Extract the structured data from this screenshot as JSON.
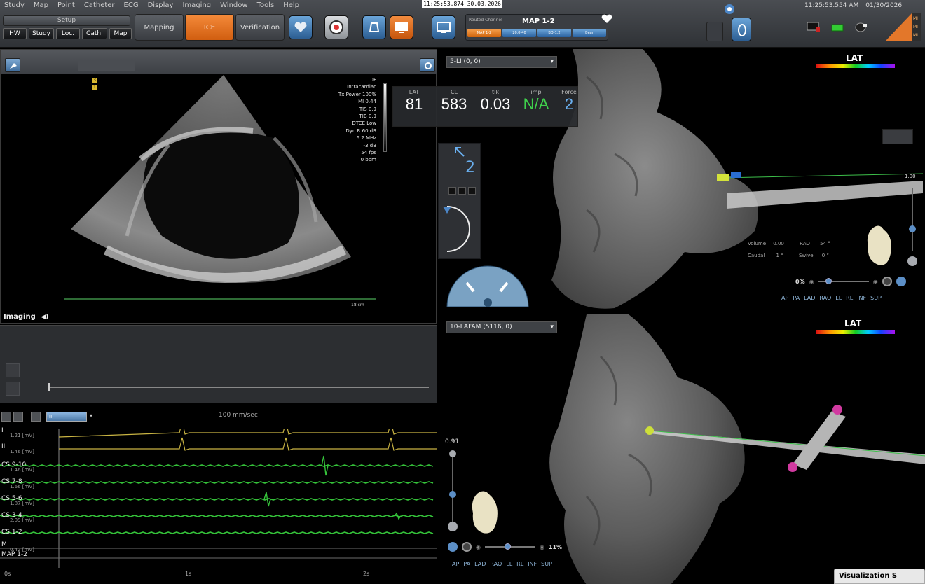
{
  "menu": [
    "Study",
    "Map",
    "Point",
    "Catheter",
    "ECG",
    "Display",
    "Imaging",
    "Window",
    "Tools",
    "Help"
  ],
  "clock_center": "11:25:53.874  30.03.2026",
  "clock_right": {
    "time": "11:25:53.554 AM",
    "date": "01/30/2026"
  },
  "setup": {
    "label": "Setup",
    "buttons": [
      "HW",
      "Study",
      "Loc.",
      "Cath.",
      "Map"
    ]
  },
  "workflow": {
    "mapping": "Mapping",
    "ice": "ICE",
    "verification": "Verification",
    "active": "ICE"
  },
  "routed_channel": {
    "label": "Routed Channel",
    "value": "MAP 1-2",
    "chips": [
      "MAP 1-2",
      "20.0-40",
      "BO-1.2",
      "Bear"
    ]
  },
  "ultrasound": {
    "params": [
      "10F",
      "Intracardiac",
      "Tx Power 100%",
      "MI 0.44",
      "TIS 0.9",
      "TIB 0.9",
      "DTCE Low",
      "Dyn R 60 dB",
      "6.2 MHz",
      "-3 dB",
      "54 fps",
      "0 bpm"
    ],
    "depth": "18 cm",
    "imaging_label": "Imaging",
    "marker_top": "3",
    "marker_bottom": "1"
  },
  "ecg": {
    "speed": "100 mm/sec",
    "dropdown": "II",
    "channels": [
      {
        "name": "I",
        "scale": "1.21 [mV]"
      },
      {
        "name": "II",
        "scale": "1.46 [mV]"
      },
      {
        "name": "CS 9-10",
        "scale": "1.46 [mV]"
      },
      {
        "name": "CS 7-8",
        "scale": "1.66 [mV]"
      },
      {
        "name": "CS 5-6",
        "scale": "1.87 [mV]"
      },
      {
        "name": "CS 3-4",
        "scale": "2.09 [mV]"
      },
      {
        "name": "CS 1-2",
        "scale": ""
      },
      {
        "name": "M",
        "scale": "0.42 [mV]"
      },
      {
        "name": "MAP 1-2",
        "scale": ""
      }
    ],
    "time_ticks": [
      "0s",
      "1s",
      "2s"
    ],
    "colors": {
      "surface": "#c9b443",
      "intracardiac": "#35c43a"
    }
  },
  "readouts": [
    {
      "label": "LAT",
      "value": "81",
      "color": "#ffffff"
    },
    {
      "label": "CL",
      "value": "583",
      "color": "#ffffff"
    },
    {
      "label": "tlk",
      "value": "0.03",
      "color": "#ffffff"
    },
    {
      "label": "imp",
      "value": "N/A",
      "color": "#3fd14c"
    },
    {
      "label": "Force",
      "value": "2",
      "color": "#6ab0f0"
    }
  ],
  "catheter_panel": {
    "number": "2"
  },
  "map_top": {
    "select": "5-LI (0, 0)",
    "lat_label": "LAT",
    "catheter_value": "1.00",
    "info": {
      "volume_label": "Volume",
      "volume": "0.00",
      "rao_label": "RAO",
      "rao": "54 °",
      "caudal_label": "Caudal",
      "caudal": "1 °",
      "swivel_label": "Swivel",
      "swivel": "0 °"
    },
    "zoom": "0%",
    "view_buttons": [
      "AP",
      "PA",
      "LAD",
      "RAO",
      "LL",
      "RL",
      "INF",
      "SUP"
    ]
  },
  "map_bottom": {
    "select": "10-LAFAM (5116, 0)",
    "lat_label": "LAT",
    "opacity": "0.91",
    "zoom": "11%",
    "view_buttons": [
      "AP",
      "PA",
      "LAD",
      "RAO",
      "LL",
      "RL",
      "INF",
      "SUP"
    ],
    "vis_tag": "Visualization S"
  }
}
